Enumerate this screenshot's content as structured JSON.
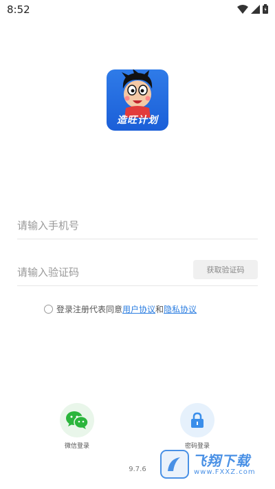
{
  "status_bar": {
    "time": "8:52"
  },
  "logo": {
    "text": "造旺计划"
  },
  "phone_input": {
    "placeholder": "请输入手机号"
  },
  "code_input": {
    "placeholder": "请输入验证码"
  },
  "get_code_button": {
    "label": "获取验证码"
  },
  "agreement": {
    "prefix": "登录注册代表同意",
    "user_agreement": "用户协议",
    "connector": "和",
    "privacy_policy": "隐私协议"
  },
  "login_options": {
    "wechat_label": "微信登录",
    "password_label": "密码登录"
  },
  "version": "9.7.6",
  "watermark": {
    "brand": "飞翔下载",
    "url": "www.FXXZ.com"
  },
  "colors": {
    "accent": "#2a7de1",
    "wechat": "#2bb53c",
    "password": "#3a8eea"
  }
}
